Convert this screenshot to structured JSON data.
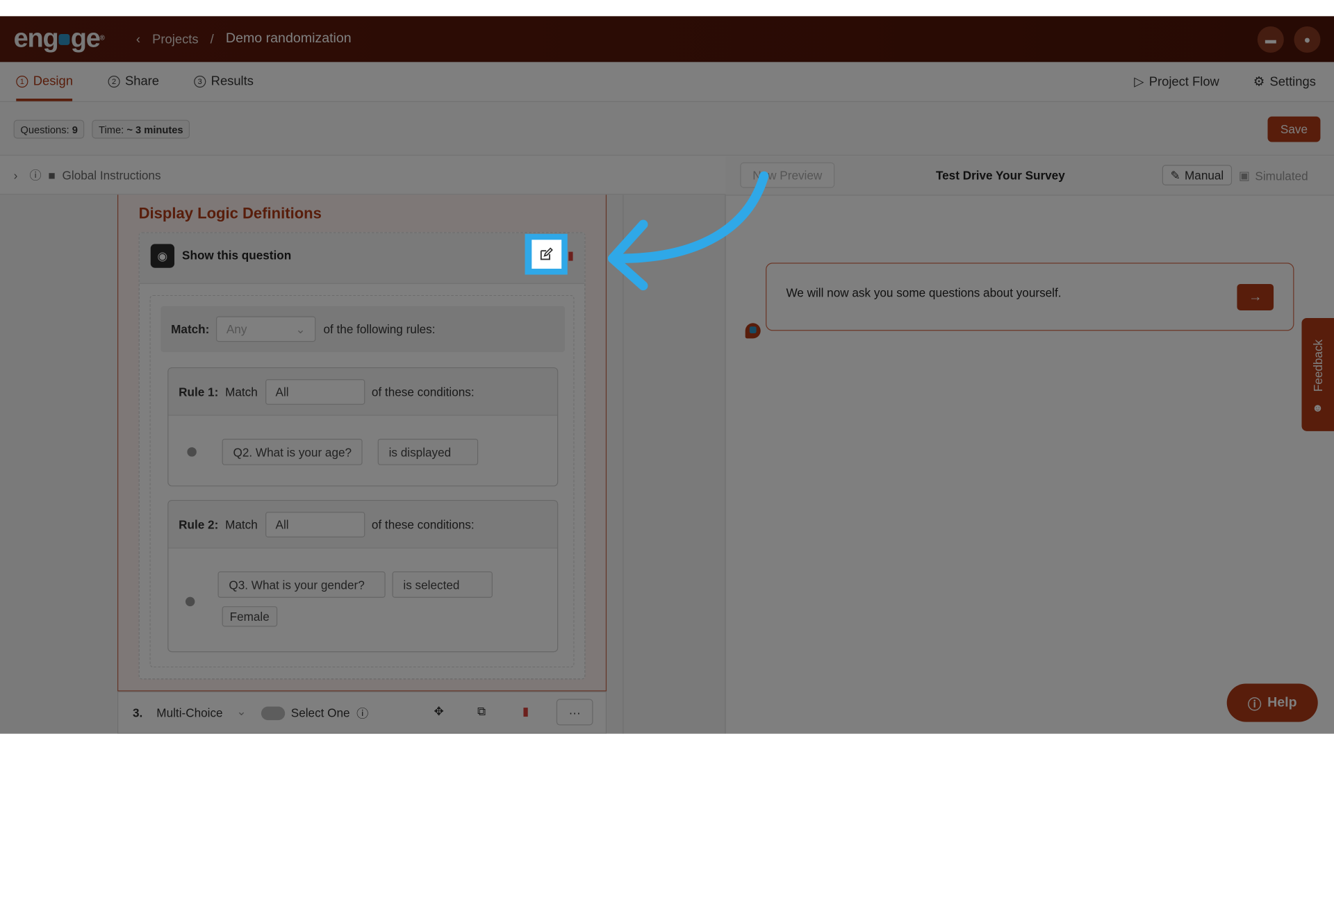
{
  "header": {
    "logo": "engage",
    "breadcrumb_back": "Projects",
    "separator": "/",
    "project_name": "Demo randomization"
  },
  "tabs": [
    {
      "number": "1",
      "label": "Design"
    },
    {
      "number": "2",
      "label": "Share"
    },
    {
      "number": "3",
      "label": "Results"
    }
  ],
  "top_actions": {
    "project_flow": "Project Flow",
    "settings": "Settings"
  },
  "infobar": {
    "questions_label": "Questions:",
    "questions_value": "9",
    "time_label": "Time:",
    "time_value": "~ 3 minutes",
    "save": "Save"
  },
  "global_instructions": "Global Instructions",
  "logic": {
    "title": "Display Logic Definitions",
    "show_label": "Show this question",
    "match_label": "Match:",
    "match_value": "Any",
    "following_rules": "of the following rules:",
    "rules": [
      {
        "label": "Rule 1:",
        "match_word": "Match",
        "match_value": "All",
        "suffix": "of these conditions:",
        "question": "Q2. What is your age?",
        "condition": "is displayed"
      },
      {
        "label": "Rule 2:",
        "match_word": "Match",
        "match_value": "All",
        "suffix": "of these conditions:",
        "question": "Q3. What is your gender?",
        "condition": "is selected",
        "option": "Female"
      }
    ]
  },
  "question_row": {
    "number": "3.",
    "type": "Multi-Choice",
    "toggle_label": "Select One",
    "more": "···"
  },
  "preview": {
    "new_preview": "New Preview",
    "title": "Test Drive Your Survey",
    "manual": "Manual",
    "simulated": "Simulated",
    "message": "We will now ask you some questions about yourself.",
    "feedback": "Feedback",
    "help": "Help"
  },
  "colors": {
    "brand": "#b03a17",
    "highlight": "#2fa8e8",
    "header_bg": "#5e1a0c"
  }
}
